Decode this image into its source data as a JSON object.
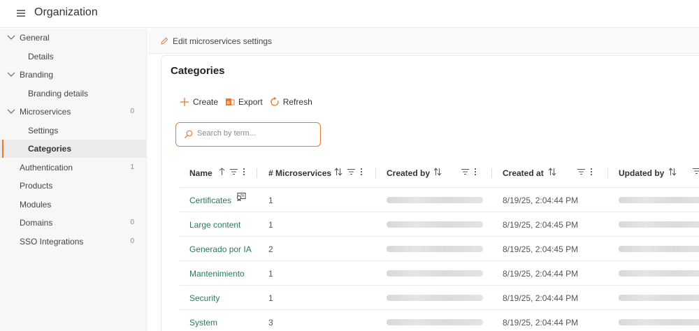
{
  "app": {
    "title": "Organization"
  },
  "sidebar": {
    "items": [
      {
        "label": "General",
        "type": "group",
        "count": ""
      },
      {
        "label": "Details",
        "type": "sub",
        "count": ""
      },
      {
        "label": "Branding",
        "type": "group",
        "count": ""
      },
      {
        "label": "Branding details",
        "type": "sub",
        "count": ""
      },
      {
        "label": "Microservices",
        "type": "group",
        "count": "0"
      },
      {
        "label": "Settings",
        "type": "sub",
        "count": ""
      },
      {
        "label": "Categories",
        "type": "sub",
        "count": "",
        "active": true
      },
      {
        "label": "Authentication",
        "type": "top",
        "count": "1"
      },
      {
        "label": "Products",
        "type": "top",
        "count": ""
      },
      {
        "label": "Modules",
        "type": "top",
        "count": ""
      },
      {
        "label": "Domains",
        "type": "top",
        "count": "0"
      },
      {
        "label": "SSO Integrations",
        "type": "top",
        "count": "0"
      }
    ]
  },
  "subheader": {
    "edit_label": "Edit microservices settings"
  },
  "page": {
    "title": "Categories"
  },
  "toolbar": {
    "create_label": "Create",
    "export_label": "Export",
    "refresh_label": "Refresh"
  },
  "search": {
    "placeholder": "Search by term..."
  },
  "table": {
    "columns": [
      "Name",
      "# Microservices",
      "Created by",
      "Created at",
      "Updated by"
    ],
    "rows": [
      {
        "name": "Certificates",
        "microservices": "1",
        "created_at": "8/19/25, 2:04:44 PM"
      },
      {
        "name": "Large content",
        "microservices": "1",
        "created_at": "8/19/25, 2:04:45 PM"
      },
      {
        "name": "Generado por IA",
        "microservices": "2",
        "created_at": "8/19/25, 2:04:45 PM"
      },
      {
        "name": "Mantenimiento",
        "microservices": "1",
        "created_at": "8/19/25, 2:04:44 PM"
      },
      {
        "name": "Security",
        "microservices": "1",
        "created_at": "8/19/25, 2:04:44 PM"
      },
      {
        "name": "System",
        "microservices": "3",
        "created_at": "8/19/25, 2:04:44 PM"
      }
    ]
  },
  "colors": {
    "accent": "#e8792d",
    "link": "#2a7a58",
    "active_bg": "#ebebeb"
  },
  "icons": {
    "menu": "hamburger-icon",
    "edit": "pencil-icon",
    "create": "plus-icon",
    "export": "office-export-icon",
    "refresh": "refresh-icon",
    "search": "search-icon",
    "sort": "sort-icon",
    "filter": "filter-icon",
    "more": "more-vertical-icon",
    "certificate": "certificate-icon"
  }
}
